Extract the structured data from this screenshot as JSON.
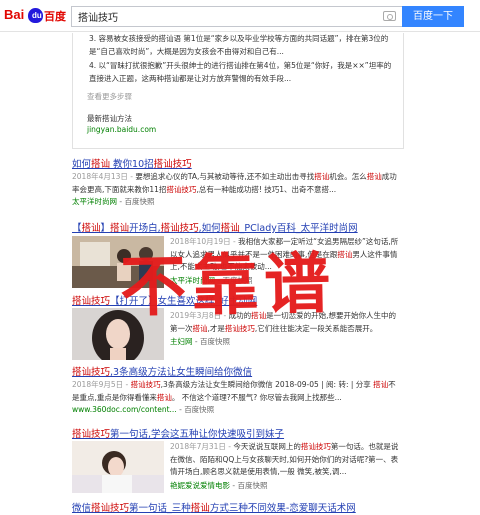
{
  "header": {
    "logo_left": "Bai",
    "logo_paw": "du",
    "logo_right": "百度",
    "query": "搭讪技巧",
    "search_button": "百度一下"
  },
  "card": {
    "item3": "3. 容易被女孩接受的搭讪语 第1位是“家乡以及毕业学校等方面的共同话题”，排在第3位的是“自己喜欢时尚”，大概是因为女孩会不由得对和自己有...",
    "item4": "4. 以“冒昧打扰很抱歉”开头很绅士的进行搭讪排在第4位，第5位是“你好，我是××”坦率的直接进入正题，这两种搭讪都是让对方放弃警惕的有效手段...",
    "more": "查看更多步骤",
    "source_title": "最新搭讪方法",
    "source_url": "jingyan.baidu.com"
  },
  "results": [
    {
      "title": "如何搭讪 教你10招搭讪技巧",
      "date": "2018年4月13日 -",
      "abstract": "要想追求心仪的TA,与其被动等待,还不如主动出击寻找搭讪机会。怎么搭讪成功率会更高,下面就来教你11招搭讪技巧,总有一种能成功搭! 技巧1、出奇不意搭...",
      "site": "太平洋时尚网",
      "sep": "-",
      "snap": "百度快照"
    },
    {
      "title": "【搭讪】搭讪开场白,搭讪技巧,如何搭讪_PClady百科_太平洋时尚网",
      "date": "2018年10月19日 -",
      "abstract": "我相信大家都一定听过“女追男隔层纱”这句话,所以女人追求男人似乎并不是一件困难的事,但是在跟搭讪男人这件事情上,不能太主动,也不能太被动...",
      "site": "太平洋时尚网",
      "sep": "-",
      "snap": "百度快照"
    },
    {
      "title": "搭讪技巧【打开了】女生喜欢这样_好主动网",
      "date": "2019年3月8日 -",
      "abstract": "成功的搭讪是一切恋爱的开始,想要开始你人生中的第一次搭讪,才是搭讪技巧,它们往往能决定一段关系能否展开。",
      "site": "主妇网",
      "sep": "-",
      "snap": "百度快照"
    },
    {
      "title": "搭讪技巧,3条高级方法让女生瞬间给你微信",
      "date": "2018年9月5日 -",
      "abstract": "搭讪技巧,3条高级方法让女生瞬间给你微信 2018-09-05 | 阅: 转: | 分享 搭讪不是重点,重点是你得看懂来搭讪。 不信这个道理?不服气? 你尽管去我网上找那些...",
      "site": "www.360doc.com/content...",
      "sep": "-",
      "snap": "百度快照"
    },
    {
      "title": "搭讪技巧第一句话,学会这五种让你快速吸引到妹子",
      "date": "2018年7月31日 -",
      "abstract": "今天说说互联网上的搭讪技巧第一句话。也就是说在微信、陌陌和QQ上与女孩聊天时,如何开始你们的对话呢?第一、表情开场白,顾名思义就是使用表情,一般 微笑,被笑,调...",
      "site": "艳妮爱说爱情电影",
      "sep": "-",
      "snap": "百度快照"
    },
    {
      "title": "微信搭讪技巧第一句话_三种搭讪方式三种不同效果-恋爱聊天话术网"
    }
  ],
  "stamp": "不靠谱"
}
